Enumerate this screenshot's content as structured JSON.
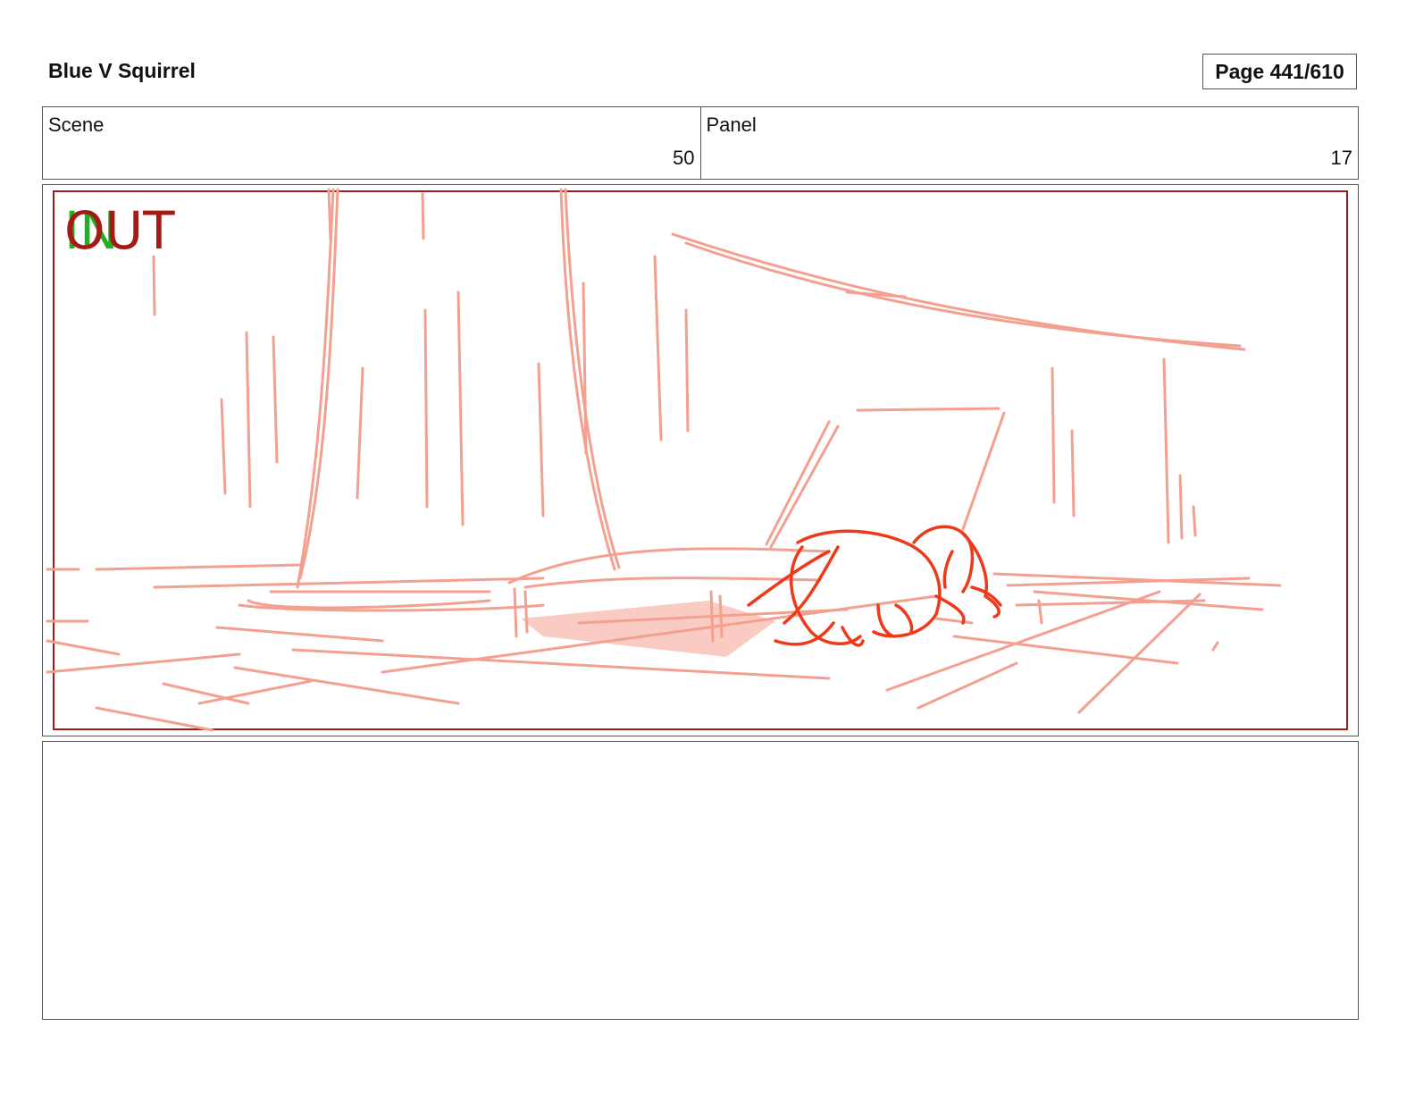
{
  "header": {
    "title": "Blue V Squirrel",
    "page": "Page 441/610"
  },
  "info": {
    "scene_label": "Scene",
    "scene_value": "50",
    "panel_label": "Panel",
    "panel_value": "17"
  },
  "frame": {
    "in_mark": "IN",
    "out_mark": "OUT",
    "colors": {
      "sketch": "#f4a090",
      "character": "#ee3a1a",
      "border": "#a31b14",
      "in": "#22b022",
      "out": "#a31b14"
    }
  },
  "notes": {
    "text": ""
  }
}
